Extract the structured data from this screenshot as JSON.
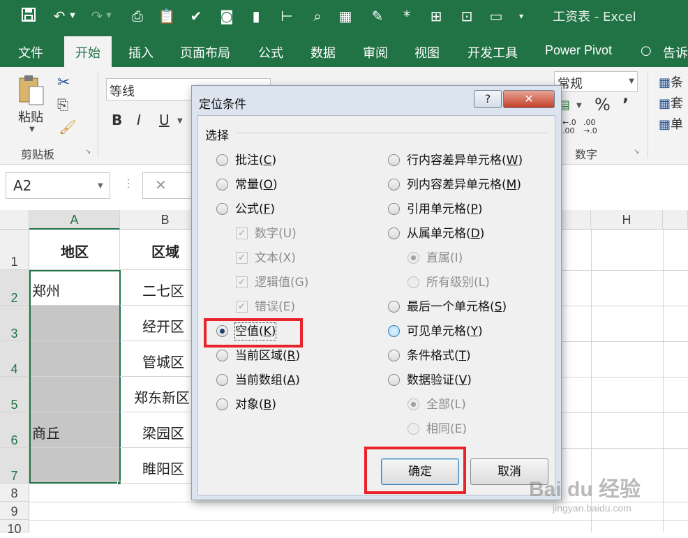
{
  "window": {
    "title": "工资表 - Excel"
  },
  "tabs": [
    "文件",
    "开始",
    "插入",
    "页面布局",
    "公式",
    "数据",
    "审阅",
    "视图",
    "开发工具",
    "Power Pivot",
    "告诉"
  ],
  "ribbon": {
    "paste_label": "粘贴",
    "clipboard_label": "剪贴板",
    "font_name": "等线",
    "bold": "B",
    "italic": "I",
    "underline": "U",
    "number_format": "常规",
    "number_label": "数字",
    "percent": "%",
    "comma": "’",
    "dec_inc": "←.0\n.00",
    "dec_dec": ".00\n→.0",
    "right_items": [
      "条",
      "套",
      "单"
    ]
  },
  "formula_bar": {
    "name_box": "A2",
    "cancel": "✕"
  },
  "grid": {
    "columns": [
      "A",
      "B",
      "H"
    ],
    "rows": [
      "1",
      "2",
      "3",
      "4",
      "5",
      "6",
      "7",
      "8",
      "9",
      "10"
    ],
    "col_a": [
      "地区",
      "郑州",
      "",
      "",
      "",
      "商丘",
      ""
    ],
    "col_b": [
      "区域",
      "二七区",
      "经开区",
      "管城区",
      "郑东新区",
      "梁园区",
      "睢阳区"
    ]
  },
  "dialog": {
    "title": "定位条件",
    "help": "?",
    "close": "✕",
    "group_label": "选择",
    "left_options": [
      {
        "pre": "批注(",
        "key": "C",
        "post": ")"
      },
      {
        "pre": "常量(",
        "key": "O",
        "post": ")"
      },
      {
        "pre": "公式(",
        "key": "F",
        "post": ")"
      },
      {
        "pre": "数字(U)",
        "key": "",
        "post": ""
      },
      {
        "pre": "文本(X)",
        "key": "",
        "post": ""
      },
      {
        "pre": "逻辑值(G)",
        "key": "",
        "post": ""
      },
      {
        "pre": "错误(E)",
        "key": "",
        "post": ""
      },
      {
        "pre": "空值(",
        "key": "K",
        "post": ")"
      },
      {
        "pre": "当前区域(",
        "key": "R",
        "post": ")"
      },
      {
        "pre": "当前数组(",
        "key": "A",
        "post": ")"
      },
      {
        "pre": "对象(",
        "key": "B",
        "post": ")"
      }
    ],
    "right_options": [
      {
        "pre": "行内容差异单元格(",
        "key": "W",
        "post": ")"
      },
      {
        "pre": "列内容差异单元格(",
        "key": "M",
        "post": ")"
      },
      {
        "pre": "引用单元格(",
        "key": "P",
        "post": ")"
      },
      {
        "pre": "从属单元格(",
        "key": "D",
        "post": ")"
      },
      {
        "pre": "直属(I)",
        "key": "",
        "post": ""
      },
      {
        "pre": "所有级别(L)",
        "key": "",
        "post": ""
      },
      {
        "pre": "最后一个单元格(",
        "key": "S",
        "post": ")"
      },
      {
        "pre": "可见单元格(",
        "key": "Y",
        "post": ")"
      },
      {
        "pre": "条件格式(",
        "key": "T",
        "post": ")"
      },
      {
        "pre": "数据验证(",
        "key": "V",
        "post": ")"
      },
      {
        "pre": "全部(L)",
        "key": "",
        "post": ""
      },
      {
        "pre": "相同(E)",
        "key": "",
        "post": ""
      }
    ],
    "ok": "确定",
    "cancel": "取消"
  },
  "watermark": {
    "logo": "Bai du 经验",
    "url": "jingyan.baidu.com"
  },
  "colors": {
    "excel_green": "#217346",
    "highlight": "#e8232a"
  }
}
